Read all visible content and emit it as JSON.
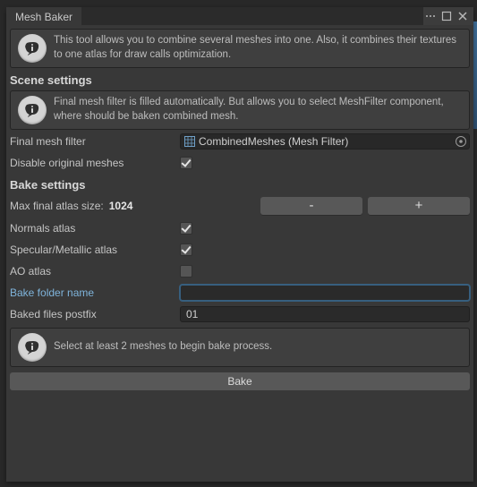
{
  "tab": {
    "title": "Mesh Baker"
  },
  "info1": "This tool allows you to combine several meshes into one. Also, it combines their textures to one atlas for draw calls optimization.",
  "section1": "Scene settings",
  "info2": "Final mesh filter is filled automatically. But allows you to select MeshFilter component, where should be baken combined mesh.",
  "fields": {
    "final_mesh_filter_label": "Final mesh filter",
    "final_mesh_filter_value": "CombinedMeshes (Mesh Filter)",
    "disable_original_label": "Disable original meshes",
    "disable_original_checked": true
  },
  "section2": "Bake settings",
  "atlas": {
    "label": "Max final atlas size: ",
    "value": "1024",
    "minus": "-",
    "plus": "+"
  },
  "opts": {
    "normals_label": "Normals atlas",
    "normals_checked": true,
    "specular_label": "Specular/Metallic atlas",
    "specular_checked": true,
    "ao_label": "AO atlas",
    "ao_checked": false,
    "folder_label": "Bake folder name",
    "folder_value": "",
    "postfix_label": "Baked files postfix",
    "postfix_value": "01"
  },
  "info3": "Select at least 2 meshes to begin bake process.",
  "bake_label": "Bake"
}
